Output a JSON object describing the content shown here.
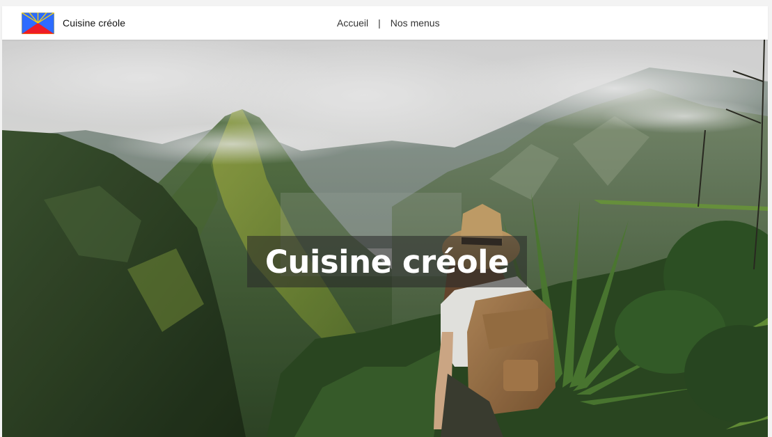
{
  "header": {
    "brand_name": "Cuisine créole",
    "logo_icon": "reunion-flag-icon",
    "nav": [
      {
        "label": "Accueil"
      },
      {
        "label": "Nos menus"
      }
    ],
    "separator": "|"
  },
  "hero": {
    "title": "Cuisine créole",
    "image_icon": "mountain-landscape-hiker-image"
  },
  "colors": {
    "flag_blue": "#2d6cff",
    "flag_red": "#ee1c25",
    "flag_yellow": "#ffd500",
    "title_text": "#ffffff",
    "title_bg": "rgba(40,40,40,0.55)",
    "nav_bg": "#ffffff"
  }
}
